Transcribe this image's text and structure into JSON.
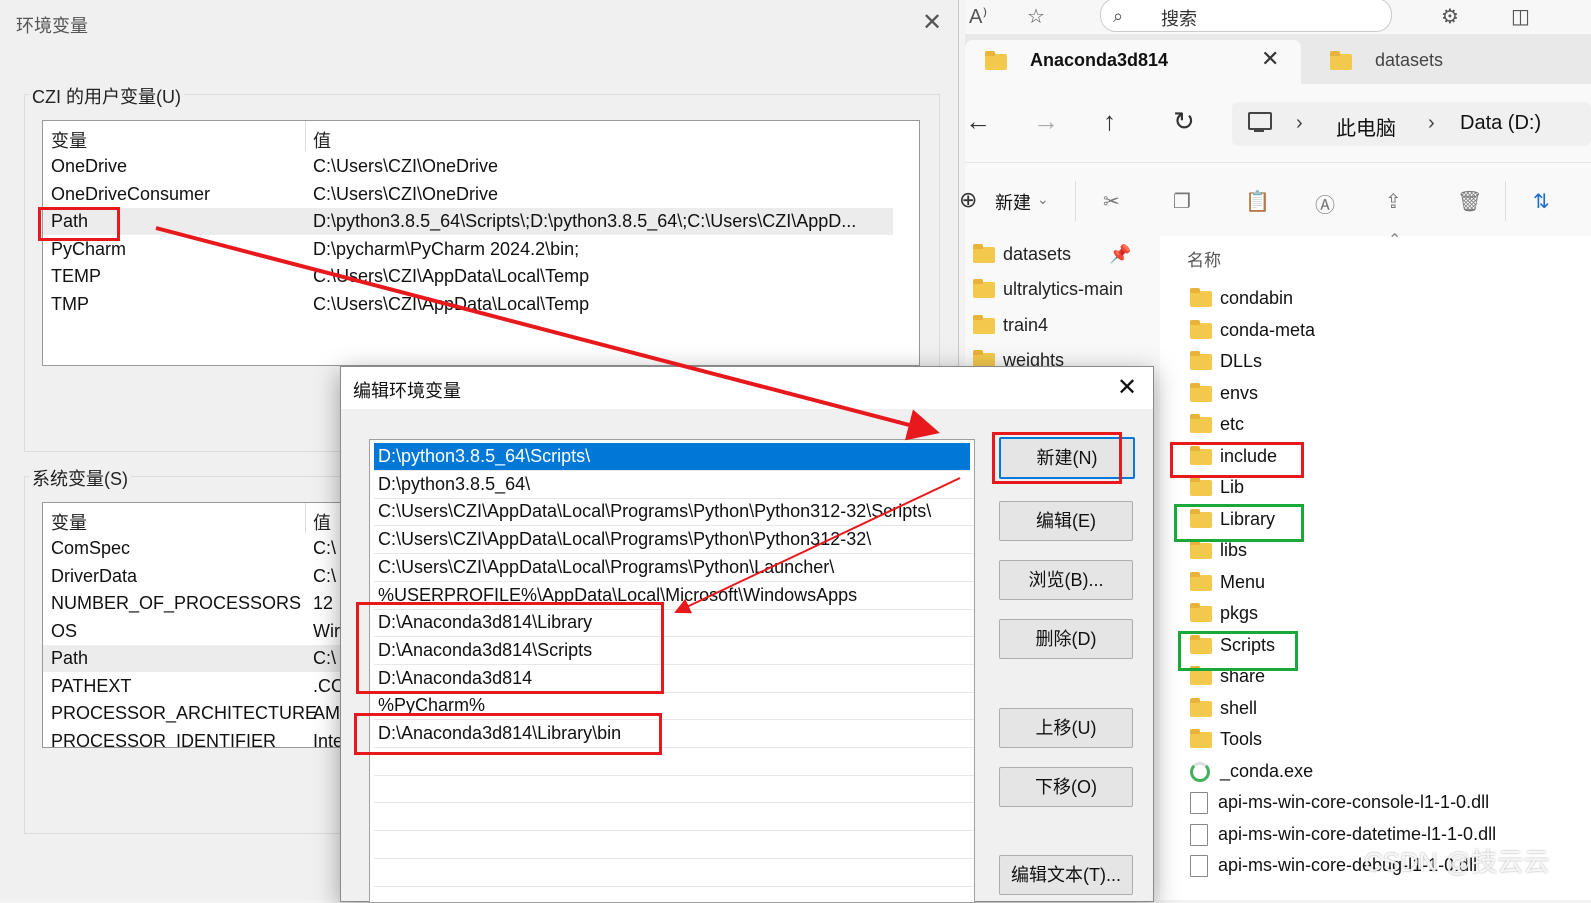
{
  "browser": {
    "search_text": "搜索"
  },
  "explorer": {
    "tabs": [
      {
        "label": "Anaconda3d814",
        "active": true
      },
      {
        "label": "datasets",
        "active": false
      }
    ],
    "breadcrumb": [
      "此电脑",
      "Data (D:)"
    ],
    "toolbar": {
      "new_label": "新建"
    },
    "nav_items": [
      "datasets",
      "ultralytics-main",
      "train4",
      "weights"
    ],
    "column_name": "名称",
    "files": [
      {
        "name": "condabin",
        "type": "folder"
      },
      {
        "name": "conda-meta",
        "type": "folder"
      },
      {
        "name": "DLLs",
        "type": "folder"
      },
      {
        "name": "envs",
        "type": "folder"
      },
      {
        "name": "etc",
        "type": "folder"
      },
      {
        "name": "include",
        "type": "folder",
        "highlight": "red"
      },
      {
        "name": "Lib",
        "type": "folder"
      },
      {
        "name": "Library",
        "type": "folder",
        "highlight": "green"
      },
      {
        "name": "libs",
        "type": "folder"
      },
      {
        "name": "Menu",
        "type": "folder"
      },
      {
        "name": "pkgs",
        "type": "folder"
      },
      {
        "name": "Scripts",
        "type": "folder",
        "highlight": "green"
      },
      {
        "name": "share",
        "type": "folder"
      },
      {
        "name": "shell",
        "type": "folder"
      },
      {
        "name": "Tools",
        "type": "folder"
      },
      {
        "name": "_conda.exe",
        "type": "exe"
      },
      {
        "name": "api-ms-win-core-console-l1-1-0.dll",
        "type": "dll"
      },
      {
        "name": "api-ms-win-core-datetime-l1-1-0.dll",
        "type": "dll"
      },
      {
        "name": "api-ms-win-core-debug-l1-1-0.dll",
        "type": "dll"
      }
    ]
  },
  "env_dialog": {
    "title": "环境变量",
    "user_group": "CZI 的用户变量(U)",
    "system_group": "系统变量(S)",
    "col_var": "变量",
    "col_val": "值",
    "user_vars": [
      {
        "name": "OneDrive",
        "value": "C:\\Users\\CZI\\OneDrive"
      },
      {
        "name": "OneDriveConsumer",
        "value": "C:\\Users\\CZI\\OneDrive"
      },
      {
        "name": "Path",
        "value": "D:\\python3.8.5_64\\Scripts\\;D:\\python3.8.5_64\\;C:\\Users\\CZI\\AppD...",
        "selected": true
      },
      {
        "name": "PyCharm",
        "value": "D:\\pycharm\\PyCharm 2024.2\\bin;"
      },
      {
        "name": "TEMP",
        "value": "C:\\Users\\CZI\\AppData\\Local\\Temp"
      },
      {
        "name": "TMP",
        "value": "C:\\Users\\CZI\\AppData\\Local\\Temp"
      }
    ],
    "system_vars": [
      {
        "name": "ComSpec",
        "value": "C:\\"
      },
      {
        "name": "DriverData",
        "value": "C:\\"
      },
      {
        "name": "NUMBER_OF_PROCESSORS",
        "value": "12"
      },
      {
        "name": "OS",
        "value": "Wir"
      },
      {
        "name": "Path",
        "value": "C:\\",
        "selected": true
      },
      {
        "name": "PATHEXT",
        "value": ".CO"
      },
      {
        "name": "PROCESSOR_ARCHITECTURE",
        "value": "AM"
      },
      {
        "name": "PROCESSOR_IDENTIFIER",
        "value": "Inte"
      }
    ]
  },
  "edit_dialog": {
    "title": "编辑环境变量",
    "paths": [
      "D:\\python3.8.5_64\\Scripts\\",
      "D:\\python3.8.5_64\\",
      "C:\\Users\\CZI\\AppData\\Local\\Programs\\Python\\Python312-32\\Scripts\\",
      "C:\\Users\\CZI\\AppData\\Local\\Programs\\Python\\Python312-32\\",
      "C:\\Users\\CZI\\AppData\\Local\\Programs\\Python\\Launcher\\",
      "%USERPROFILE%\\AppData\\Local\\Microsoft\\WindowsApps",
      "D:\\Anaconda3d814\\Library",
      "D:\\Anaconda3d814\\Scripts",
      "D:\\Anaconda3d814",
      "%PyCharm%",
      "D:\\Anaconda3d814\\Library\\bin"
    ],
    "buttons": {
      "new": "新建(N)",
      "edit": "编辑(E)",
      "browse": "浏览(B)...",
      "delete": "删除(D)",
      "move_up": "上移(U)",
      "move_down": "下移(O)",
      "edit_text": "编辑文本(T)..."
    }
  },
  "watermark": "CSDN @技云云"
}
